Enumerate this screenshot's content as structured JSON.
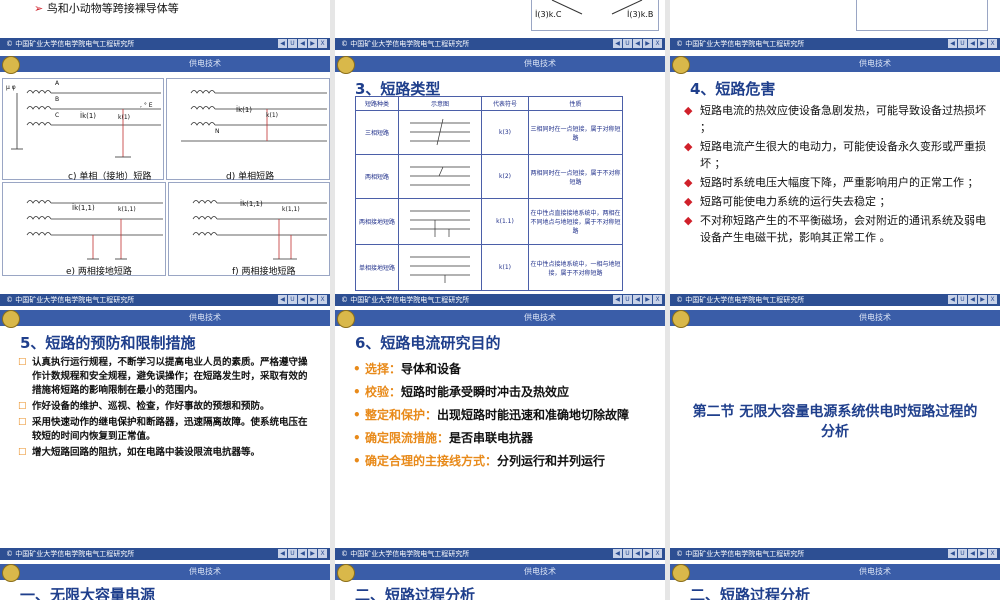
{
  "footer_text": "© 中国矿业大学信电学院电气工程研究所",
  "header_text": "供电技术",
  "nav": [
    "◀",
    "U",
    "◀",
    "▶",
    "X"
  ],
  "s_top_left": {
    "bullet": "鸟和小动物等跨接裸导体等"
  },
  "s_top_mid": {
    "label_c": "İ(3)k.C",
    "label_b": "İ(3)k.B"
  },
  "s_diagrams": {
    "captions": [
      "c) 单相（接地）短路",
      "d) 单相短路",
      "e) 两相接地短路",
      "f) 两相接地短路"
    ],
    "phase_a": "A",
    "phase_b": "B",
    "phase_c": "C",
    "phase_n": "N",
    "src": "μ  φ",
    "load": ", ° E",
    "ik1": "İk(1)",
    "k1": "k(1)",
    "ik11": "İk(1,1)",
    "k11": "k(1,1)"
  },
  "s_types": {
    "title": "3、短路类型",
    "headers": [
      "短路种类",
      "示意图",
      "代表符号",
      "性质"
    ],
    "rows": [
      {
        "name": "三相短路",
        "sym": "k(3)",
        "prop": "三相同时在一点短接，属于对称短路"
      },
      {
        "name": "两相短路",
        "sym": "k(2)",
        "prop": "两相同时在一点短接，属于不对称短路"
      },
      {
        "name": "两相接地短路",
        "sym": "k(1.1)",
        "prop": "在中性点直接接地系统中，两相在不同地点与地短接，属于不对称短路"
      },
      {
        "name": "单相接地短路",
        "sym": "k(1)",
        "prop": "在中性点接地系统中，一相与地短接，属于不对称短路"
      }
    ]
  },
  "s_harm": {
    "title": "4、短路危害",
    "items": [
      "短路电流的热效应使设备急剧发热，可能导致设备过热损坏 ；",
      "短路电流产生很大的电动力，可能使设备永久变形或严重损坏 ；",
      "短路时系统电压大幅度下降，严重影响用户的正常工作 ；",
      "短路可能使电力系统的运行失去稳定 ；",
      "不对称短路产生的不平衡磁场，会对附近的通讯系统及弱电设备产生电磁干扰，影响其正常工作 。"
    ]
  },
  "s_prevent": {
    "title": "5、短路的预防和限制措施",
    "items": [
      "认真执行运行规程，不断学习以提高电业人员的素质。严格遵守操作计数规程和安全规程，避免误操作；在短路发生时，采取有效的措施将短路的影响限制在最小的范围内。",
      "作好设备的维护、巡视、检查，作好事故的预想和预防。",
      "采用快速动作的继电保护和断路器，迅速隔离故障。使系统电压在较短的时间内恢复到正常值。",
      "增大短路回路的阻抗，如在电路中装设限流电抗器等。"
    ]
  },
  "s_purpose": {
    "title": "6、短路电流研究目的",
    "items": [
      {
        "k": "选择：",
        "v": "导体和设备"
      },
      {
        "k": "校验：",
        "v": "短路时能承受瞬时冲击及热效应"
      },
      {
        "k": "整定和保护：",
        "v": "出现短路时能迅速和准确地切除故障"
      },
      {
        "k": "确定限流措施：",
        "v": "是否串联电抗器"
      },
      {
        "k": "确定合理的主接线方式：",
        "v": "分列运行和并列运行"
      }
    ]
  },
  "s_section": {
    "title": "第二节  无限大容量电源系统供电时短路过程的分析"
  },
  "s_bottom": [
    "一、无限大容量电源",
    "二、短路过程分析",
    "二、短路过程分析"
  ],
  "colors": {
    "accent": "#1f3f8c",
    "bar": "#2d4f93",
    "bullet_red": "#d0202a",
    "bullet_orange": "#e88a1a"
  }
}
